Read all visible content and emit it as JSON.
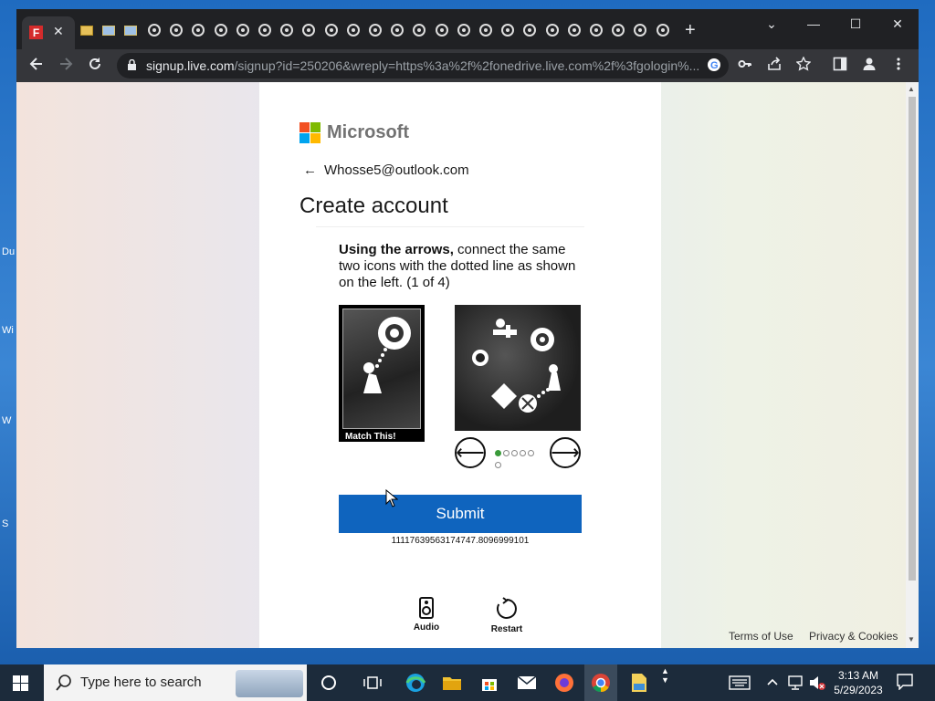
{
  "desktop": {
    "fragments": [
      "Du",
      "Wi",
      "W",
      "S"
    ]
  },
  "browser": {
    "tab_close": "✕",
    "new_tab": "+",
    "window_controls": {
      "dropdown": "⌄",
      "minimize": "—",
      "maximize": "☐",
      "close": "✕"
    },
    "url_host": "signup.live.com",
    "url_rest": "/signup?id=250206&wreply=https%3a%2f%2fonedrive.live.com%2f%3fgologin%...",
    "icons": [
      "back-icon",
      "forward-icon",
      "reload-icon",
      "lock-icon",
      "google-icon",
      "key-icon",
      "share-icon",
      "star-icon",
      "side-panel-icon",
      "profile-icon",
      "menu-icon"
    ]
  },
  "page": {
    "brand": "Microsoft",
    "back_email": "Whosse5@outlook.com",
    "title": "Create account",
    "instruction_bold": "Using the arrows,",
    "instruction_rest": " connect the same two icons with the dotted line as shown on the left. (1 of 4)",
    "match_label": "Match This!",
    "submit_label": "Submit",
    "session_id": "11117639563174747.8096999101",
    "audio_label": "Audio",
    "restart_label": "Restart",
    "terms_label": "Terms of Use",
    "privacy_label": "Privacy & Cookies",
    "pagination": {
      "total": 6,
      "current": 1
    }
  },
  "taskbar": {
    "search_placeholder": "Type here to search",
    "time": "3:13 AM",
    "date": "5/29/2023"
  },
  "colors": {
    "submit": "#0f64be",
    "ms_red": "#f25022",
    "ms_green": "#7fba00",
    "ms_blue": "#00a4ef",
    "ms_yellow": "#ffb900"
  }
}
